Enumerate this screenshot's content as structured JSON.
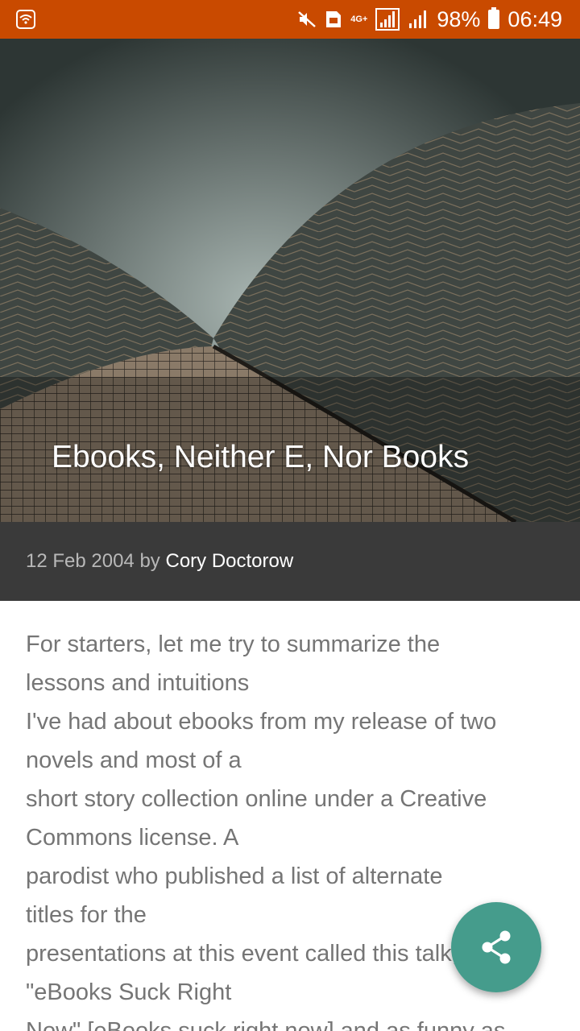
{
  "status_bar": {
    "network_type": "4G+",
    "battery": "98%",
    "time": "06:49",
    "icons": [
      "wifi-icon",
      "mute-icon",
      "sim-icon",
      "signal-icon",
      "signal-icon-2",
      "battery-icon"
    ]
  },
  "colors": {
    "status_bar": "#c94a00",
    "meta_bar": "#3a3a3a",
    "fab": "#459c8c",
    "body_text": "#757575"
  },
  "article": {
    "title": "Ebooks, Neither E, Nor Books",
    "date": "12 Feb 2004",
    "by": "by",
    "author": "Cory Doctorow",
    "body_lines": [
      "For starters, let me try to summarize the",
      "lessons and intuitions",
      "I've had about ebooks from my release of two",
      "novels and most of a",
      "short story collection online under a Creative",
      "Commons license. A",
      "parodist who published a list of alternate",
      "titles for the",
      "presentations at this event called this talk,",
      "\"eBooks Suck Right",
      "Now\" [eBooks suck right now] and as funny as"
    ]
  },
  "fab": {
    "icon": "share-icon"
  }
}
